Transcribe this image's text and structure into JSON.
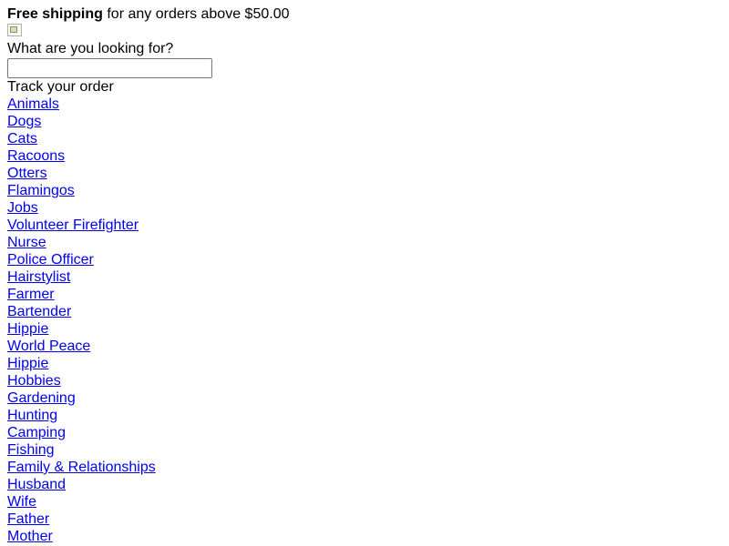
{
  "shipping_banner": {
    "bold_text": "Free shipping",
    "rest_text": " for any orders above $50.00"
  },
  "logo": {
    "icon": "broken-image-icon"
  },
  "search": {
    "label": "What are you looking for?",
    "value": "",
    "placeholder": ""
  },
  "track_order": {
    "label": "Track your order"
  },
  "nav": {
    "links": [
      "Animals",
      "Dogs",
      "Cats",
      "Racoons",
      "Otters",
      "Flamingos",
      "Jobs",
      "Volunteer Firefighter",
      "Nurse",
      "Police Officer",
      "Hairstylist",
      "Farmer",
      "Bartender",
      "Hippie",
      "World Peace",
      "Hippie",
      "Hobbies",
      "Gardening",
      "Hunting",
      "Camping",
      "Fishing",
      "Family & Relationships",
      "Husband",
      "Wife",
      "Father",
      "Mother"
    ]
  },
  "colors": {
    "link": "#0000ee",
    "text": "#000000",
    "background": "#ffffff"
  }
}
